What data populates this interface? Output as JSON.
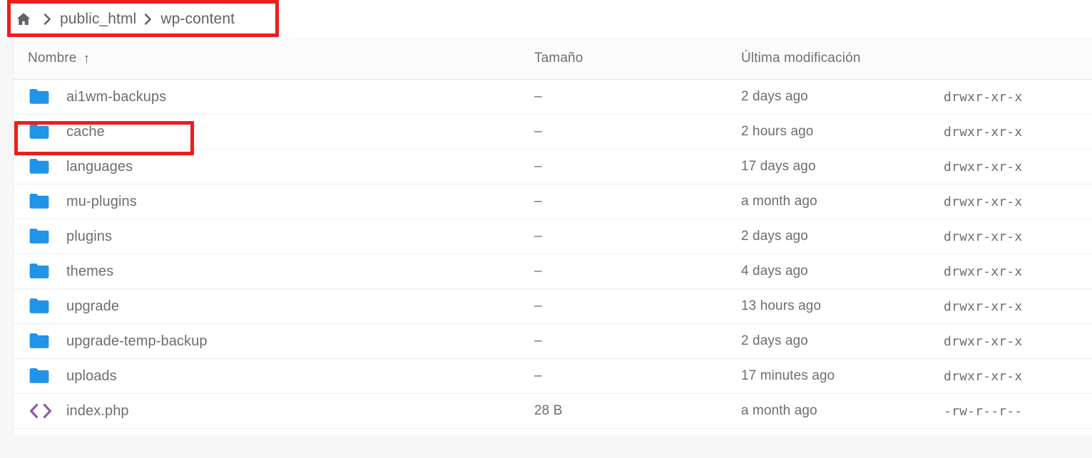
{
  "breadcrumb": {
    "home_icon": "home-icon",
    "separator": "chevron-right-icon",
    "items": [
      {
        "label": "public_html"
      },
      {
        "label": "wp-content"
      }
    ]
  },
  "table": {
    "columns": {
      "name": "Nombre",
      "name_sort": "↑",
      "size": "Tamaño",
      "modified": "Última modificación",
      "permissions": ""
    },
    "rows": [
      {
        "icon": "folder-icon",
        "name": "ai1wm-backups",
        "size": "–",
        "modified": "2 days ago",
        "permissions": "drwxr-xr-x"
      },
      {
        "icon": "folder-icon",
        "name": "cache",
        "size": "–",
        "modified": "2 hours ago",
        "permissions": "drwxr-xr-x"
      },
      {
        "icon": "folder-icon",
        "name": "languages",
        "size": "–",
        "modified": "17 days ago",
        "permissions": "drwxr-xr-x"
      },
      {
        "icon": "folder-icon",
        "name": "mu-plugins",
        "size": "–",
        "modified": "a month ago",
        "permissions": "drwxr-xr-x"
      },
      {
        "icon": "folder-icon",
        "name": "plugins",
        "size": "–",
        "modified": "2 days ago",
        "permissions": "drwxr-xr-x"
      },
      {
        "icon": "folder-icon",
        "name": "themes",
        "size": "–",
        "modified": "4 days ago",
        "permissions": "drwxr-xr-x"
      },
      {
        "icon": "folder-icon",
        "name": "upgrade",
        "size": "–",
        "modified": "13 hours ago",
        "permissions": "drwxr-xr-x"
      },
      {
        "icon": "folder-icon",
        "name": "upgrade-temp-backup",
        "size": "–",
        "modified": "2 days ago",
        "permissions": "drwxr-xr-x"
      },
      {
        "icon": "folder-icon",
        "name": "uploads",
        "size": "–",
        "modified": "17 minutes ago",
        "permissions": "drwxr-xr-x"
      },
      {
        "icon": "code-file-icon",
        "name": "index.php",
        "size": "28 B",
        "modified": "a month ago",
        "permissions": "-rw-r--r--"
      }
    ]
  },
  "annotations": [
    {
      "name": "breadcrumb-highlight",
      "color": "#ee1d1d"
    },
    {
      "name": "cache-row-highlight",
      "color": "#ee1d1d"
    }
  ],
  "colors": {
    "folder": "#1f94e8",
    "code_file": "#8e5ba6",
    "text": "#6b6e72",
    "annotation": "#ee1d1d",
    "panel_bg": "#ffffff",
    "page_bg": "#f7f7f8"
  }
}
